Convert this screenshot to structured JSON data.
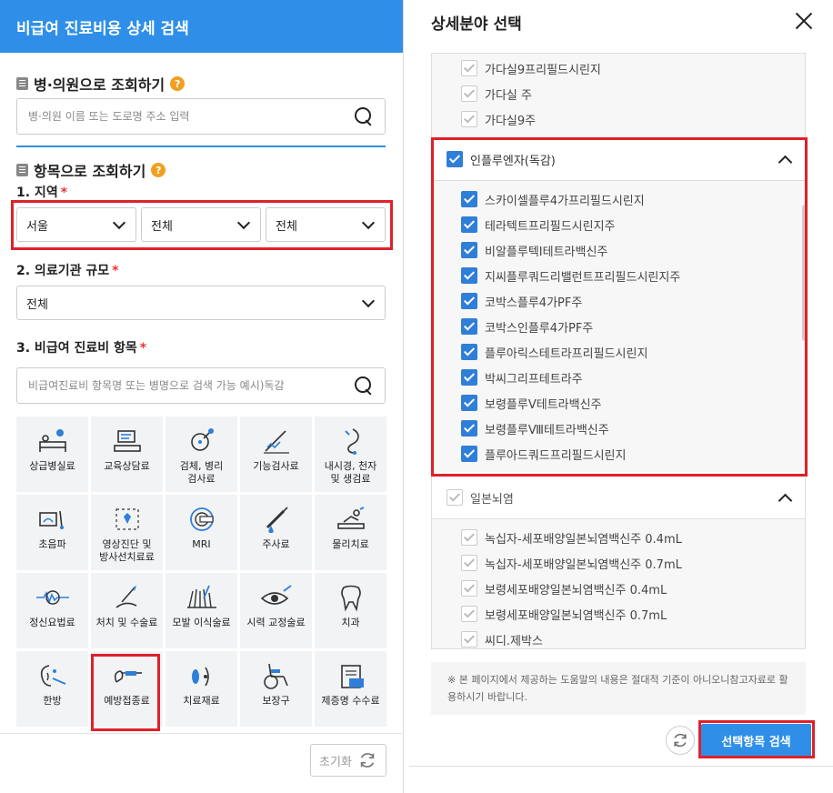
{
  "left": {
    "header": "비급여 진료비용 상세 검색",
    "hospital_section": "병·의원으로 조회하기",
    "hospital_placeholder": "병·의원 이름 또는 도로명 주소 입력",
    "item_section": "항목으로 조회하기",
    "help_glyph": "?",
    "region_label": "1. 지역",
    "required_mark": "*",
    "region_selects": [
      "서울",
      "전체",
      "전체"
    ],
    "scale_label": "2. 의료기관 규모",
    "scale_value": "전체",
    "item_label": "3. 비급여 진료비 항목",
    "item_placeholder": "비급여진료비 항목명 또는 병명으로 검색 가능 예시)독감",
    "tiles": [
      {
        "label": "상급병실료",
        "icon": "bed-icon"
      },
      {
        "label": "교육상담료",
        "icon": "counsel-icon"
      },
      {
        "label": "검체, 병리\n검사료",
        "icon": "specimen-icon"
      },
      {
        "label": "기능검사료",
        "icon": "function-test-icon"
      },
      {
        "label": "내시경, 천자\n및 생검료",
        "icon": "endoscope-icon"
      },
      {
        "label": "초음파",
        "icon": "ultrasound-icon"
      },
      {
        "label": "영상진단 및\n방사선치료료",
        "icon": "radiology-icon"
      },
      {
        "label": "MRI",
        "icon": "mri-icon"
      },
      {
        "label": "주사료",
        "icon": "syringe-icon"
      },
      {
        "label": "물리치료",
        "icon": "physio-icon"
      },
      {
        "label": "정신요법료",
        "icon": "brainwave-icon"
      },
      {
        "label": "처치 및 수술료",
        "icon": "surgery-icon"
      },
      {
        "label": "모발 이식술료",
        "icon": "hair-icon"
      },
      {
        "label": "시력 교정술료",
        "icon": "eye-icon"
      },
      {
        "label": "치과",
        "icon": "tooth-icon"
      },
      {
        "label": "한방",
        "icon": "acupuncture-icon"
      },
      {
        "label": "예방접종료",
        "icon": "vaccine-icon"
      },
      {
        "label": "치료재료",
        "icon": "material-icon"
      },
      {
        "label": "보장구",
        "icon": "wheelchair-icon"
      },
      {
        "label": "제증명 수수료",
        "icon": "certificate-icon"
      }
    ],
    "reset_label": "초기화"
  },
  "right": {
    "title": "상세분야 선택",
    "top_items": [
      "가다실9프리필드시린지",
      "가다실 주",
      "가다실9주"
    ],
    "group1": {
      "name": "인플루엔자(독감)",
      "items": [
        "스카이셀플루4가프리필드시린지",
        "테라텍트프리필드시린지주",
        "비알플루텍I테트라백신주",
        "지씨플루쿼드리밸런트프리필드시린지주",
        "코박스플루4가PF주",
        "코박스인플루4가PF주",
        "플루아릭스테트라프리필드시린지",
        "박씨그리프테트라주",
        "보령플루Ⅴ테트라백신주",
        "보령플루Ⅷ테트라백신주",
        "플루아드쿼드프리필드시린지"
      ]
    },
    "group2": {
      "name": "일본뇌염",
      "items": [
        "녹십자-세포배양일본뇌염백신주 0.4mL",
        "녹십자-세포배양일본뇌염백신주 0.7mL",
        "보령세포배양일본뇌염백신주 0.4mL",
        "보령세포배양일본뇌염백신주 0.7mL",
        "씨디.제박스"
      ]
    },
    "notice": "※ 본 페이지에서 제공하는 도움말의 내용은 절대적 기준이 아니오니참고자료로 활용하시기 바랍니다.",
    "search_button": "선택항목 검색"
  }
}
